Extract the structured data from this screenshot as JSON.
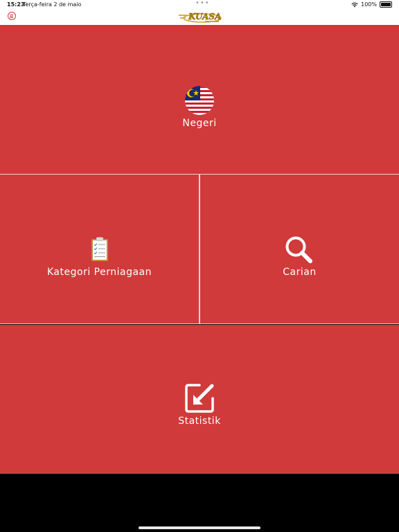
{
  "status_bar": {
    "time": "15:23",
    "date": "Terça-feira 2 de maio",
    "dots": "•••",
    "battery_percent": "100%",
    "battery_level": 1.0
  },
  "nav": {
    "logo_text": "KUASA"
  },
  "tiles": {
    "negeri": {
      "label": "Negeri",
      "icon": "malaysia-flag-icon"
    },
    "kategori": {
      "label": "Kategori Perniagaan",
      "icon": "clipboard-checklist-icon"
    },
    "carian": {
      "label": "Carian",
      "icon": "magnifier-icon"
    },
    "statistik": {
      "label": "Statistik",
      "icon": "export-arrow-icon"
    }
  },
  "colors": {
    "tile_bg": "#d03a3b",
    "divider": "#f3d0d0",
    "accent": "#d23b3c"
  }
}
